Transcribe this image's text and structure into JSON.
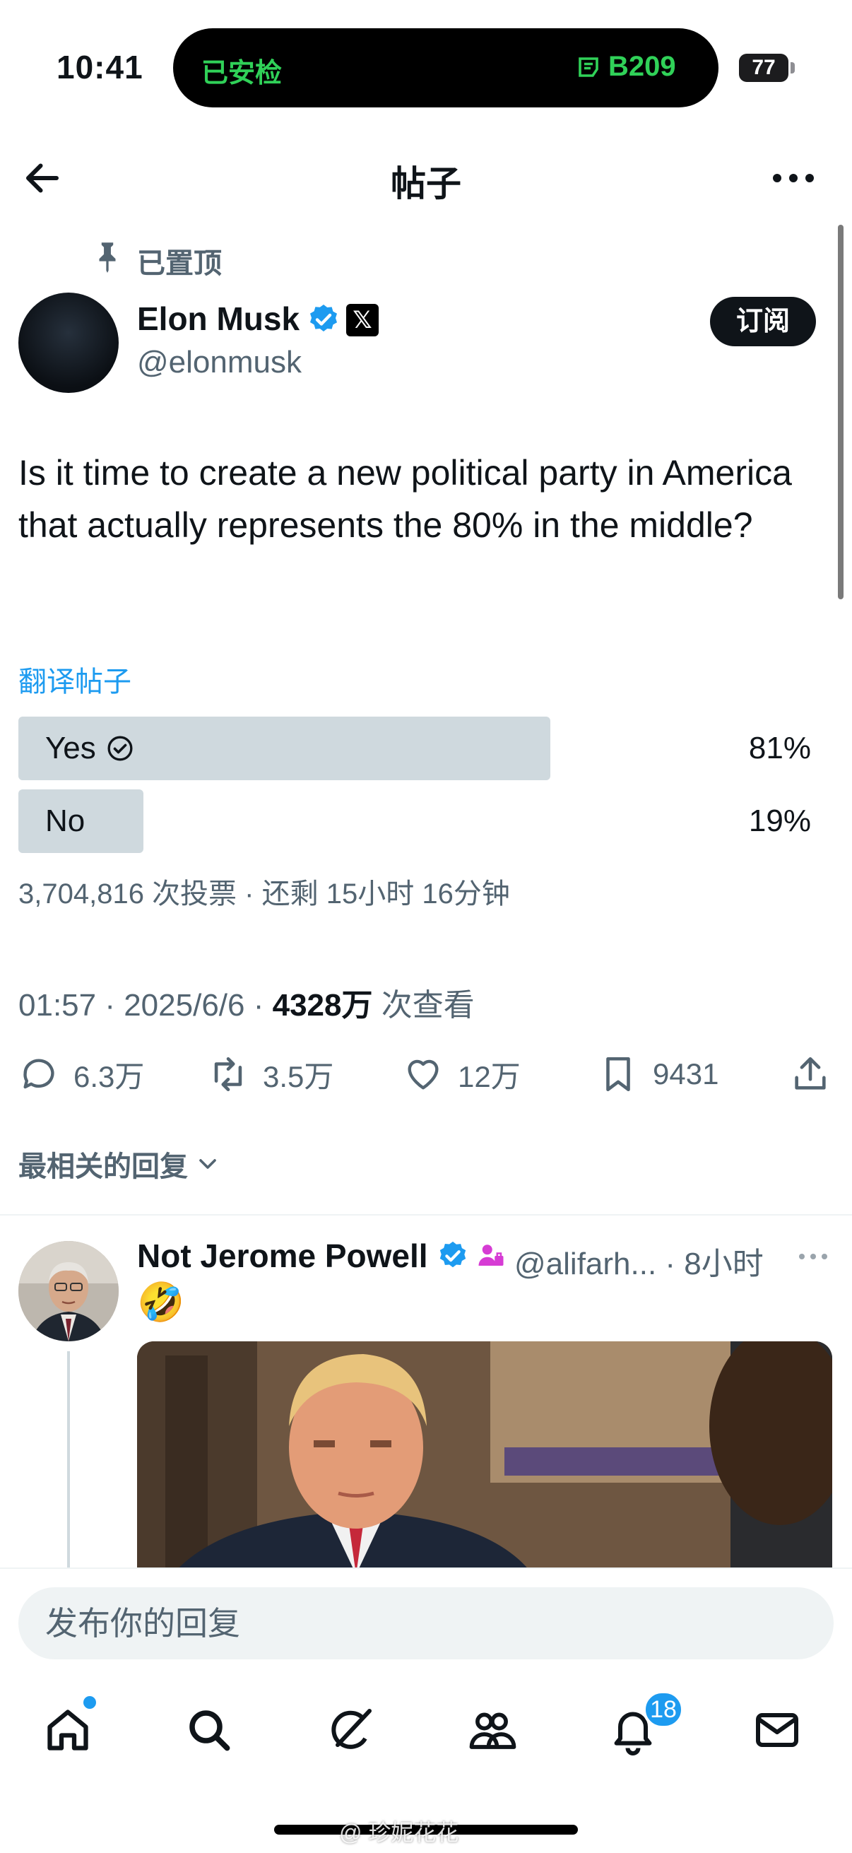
{
  "status_bar": {
    "time": "10:41",
    "island_left": "已安检",
    "island_right": "B209",
    "battery": "77"
  },
  "header": {
    "title": "帖子"
  },
  "post": {
    "pinned_label": "已置顶",
    "author_name": "Elon Musk",
    "x_badge": "𝕏",
    "handle": "@elonmusk",
    "subscribe_label": "订阅",
    "text": "Is it time to create a new political party in America that actually represents the 80% in the middle?",
    "translate_label": "翻译帖子",
    "poll": {
      "options": [
        {
          "label": "Yes",
          "percent_label": "81%",
          "fraction": 0.81,
          "chosen": true
        },
        {
          "label": "No",
          "percent_label": "19%",
          "fraction": 0.19,
          "chosen": false
        }
      ],
      "meta": "3,704,816 次投票 · 还剩 15小时 16分钟"
    },
    "meta": {
      "timestamp": "01:57 · 2025/6/6 · ",
      "views": "4328万",
      "views_suffix": " 次查看"
    },
    "actions": {
      "replies": "6.3万",
      "reposts": "3.5万",
      "likes": "12万",
      "bookmarks": "9431"
    }
  },
  "replies_sort_label": "最相关的回复",
  "reply": {
    "name": "Not Jerome Powell",
    "handle": "@alifarh... · 8小时",
    "emoji": "🤣"
  },
  "composer": {
    "placeholder": "发布你的回复"
  },
  "bottom_nav": {
    "notifications_badge": "18"
  },
  "watermark": "@ 珍妮花花",
  "colors": {
    "accent": "#1d9bf0",
    "island_text": "#30d158",
    "muted": "#536471",
    "poll_bar": "#cfd9de"
  }
}
